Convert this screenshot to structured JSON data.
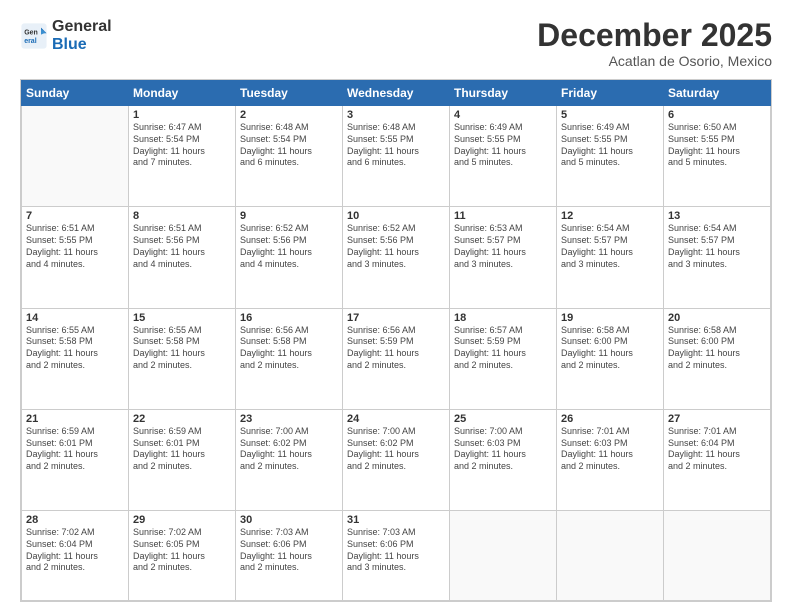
{
  "header": {
    "logo_general": "General",
    "logo_blue": "Blue",
    "month_title": "December 2025",
    "location": "Acatlan de Osorio, Mexico"
  },
  "days_of_week": [
    "Sunday",
    "Monday",
    "Tuesday",
    "Wednesday",
    "Thursday",
    "Friday",
    "Saturday"
  ],
  "weeks": [
    [
      {
        "day": "",
        "content": ""
      },
      {
        "day": "1",
        "content": "Sunrise: 6:47 AM\nSunset: 5:54 PM\nDaylight: 11 hours\nand 7 minutes."
      },
      {
        "day": "2",
        "content": "Sunrise: 6:48 AM\nSunset: 5:54 PM\nDaylight: 11 hours\nand 6 minutes."
      },
      {
        "day": "3",
        "content": "Sunrise: 6:48 AM\nSunset: 5:55 PM\nDaylight: 11 hours\nand 6 minutes."
      },
      {
        "day": "4",
        "content": "Sunrise: 6:49 AM\nSunset: 5:55 PM\nDaylight: 11 hours\nand 5 minutes."
      },
      {
        "day": "5",
        "content": "Sunrise: 6:49 AM\nSunset: 5:55 PM\nDaylight: 11 hours\nand 5 minutes."
      },
      {
        "day": "6",
        "content": "Sunrise: 6:50 AM\nSunset: 5:55 PM\nDaylight: 11 hours\nand 5 minutes."
      }
    ],
    [
      {
        "day": "7",
        "content": "Sunrise: 6:51 AM\nSunset: 5:55 PM\nDaylight: 11 hours\nand 4 minutes."
      },
      {
        "day": "8",
        "content": "Sunrise: 6:51 AM\nSunset: 5:56 PM\nDaylight: 11 hours\nand 4 minutes."
      },
      {
        "day": "9",
        "content": "Sunrise: 6:52 AM\nSunset: 5:56 PM\nDaylight: 11 hours\nand 4 minutes."
      },
      {
        "day": "10",
        "content": "Sunrise: 6:52 AM\nSunset: 5:56 PM\nDaylight: 11 hours\nand 3 minutes."
      },
      {
        "day": "11",
        "content": "Sunrise: 6:53 AM\nSunset: 5:57 PM\nDaylight: 11 hours\nand 3 minutes."
      },
      {
        "day": "12",
        "content": "Sunrise: 6:54 AM\nSunset: 5:57 PM\nDaylight: 11 hours\nand 3 minutes."
      },
      {
        "day": "13",
        "content": "Sunrise: 6:54 AM\nSunset: 5:57 PM\nDaylight: 11 hours\nand 3 minutes."
      }
    ],
    [
      {
        "day": "14",
        "content": "Sunrise: 6:55 AM\nSunset: 5:58 PM\nDaylight: 11 hours\nand 2 minutes."
      },
      {
        "day": "15",
        "content": "Sunrise: 6:55 AM\nSunset: 5:58 PM\nDaylight: 11 hours\nand 2 minutes."
      },
      {
        "day": "16",
        "content": "Sunrise: 6:56 AM\nSunset: 5:58 PM\nDaylight: 11 hours\nand 2 minutes."
      },
      {
        "day": "17",
        "content": "Sunrise: 6:56 AM\nSunset: 5:59 PM\nDaylight: 11 hours\nand 2 minutes."
      },
      {
        "day": "18",
        "content": "Sunrise: 6:57 AM\nSunset: 5:59 PM\nDaylight: 11 hours\nand 2 minutes."
      },
      {
        "day": "19",
        "content": "Sunrise: 6:58 AM\nSunset: 6:00 PM\nDaylight: 11 hours\nand 2 minutes."
      },
      {
        "day": "20",
        "content": "Sunrise: 6:58 AM\nSunset: 6:00 PM\nDaylight: 11 hours\nand 2 minutes."
      }
    ],
    [
      {
        "day": "21",
        "content": "Sunrise: 6:59 AM\nSunset: 6:01 PM\nDaylight: 11 hours\nand 2 minutes."
      },
      {
        "day": "22",
        "content": "Sunrise: 6:59 AM\nSunset: 6:01 PM\nDaylight: 11 hours\nand 2 minutes."
      },
      {
        "day": "23",
        "content": "Sunrise: 7:00 AM\nSunset: 6:02 PM\nDaylight: 11 hours\nand 2 minutes."
      },
      {
        "day": "24",
        "content": "Sunrise: 7:00 AM\nSunset: 6:02 PM\nDaylight: 11 hours\nand 2 minutes."
      },
      {
        "day": "25",
        "content": "Sunrise: 7:00 AM\nSunset: 6:03 PM\nDaylight: 11 hours\nand 2 minutes."
      },
      {
        "day": "26",
        "content": "Sunrise: 7:01 AM\nSunset: 6:03 PM\nDaylight: 11 hours\nand 2 minutes."
      },
      {
        "day": "27",
        "content": "Sunrise: 7:01 AM\nSunset: 6:04 PM\nDaylight: 11 hours\nand 2 minutes."
      }
    ],
    [
      {
        "day": "28",
        "content": "Sunrise: 7:02 AM\nSunset: 6:04 PM\nDaylight: 11 hours\nand 2 minutes."
      },
      {
        "day": "29",
        "content": "Sunrise: 7:02 AM\nSunset: 6:05 PM\nDaylight: 11 hours\nand 2 minutes."
      },
      {
        "day": "30",
        "content": "Sunrise: 7:03 AM\nSunset: 6:06 PM\nDaylight: 11 hours\nand 2 minutes."
      },
      {
        "day": "31",
        "content": "Sunrise: 7:03 AM\nSunset: 6:06 PM\nDaylight: 11 hours\nand 3 minutes."
      },
      {
        "day": "",
        "content": ""
      },
      {
        "day": "",
        "content": ""
      },
      {
        "day": "",
        "content": ""
      }
    ]
  ]
}
